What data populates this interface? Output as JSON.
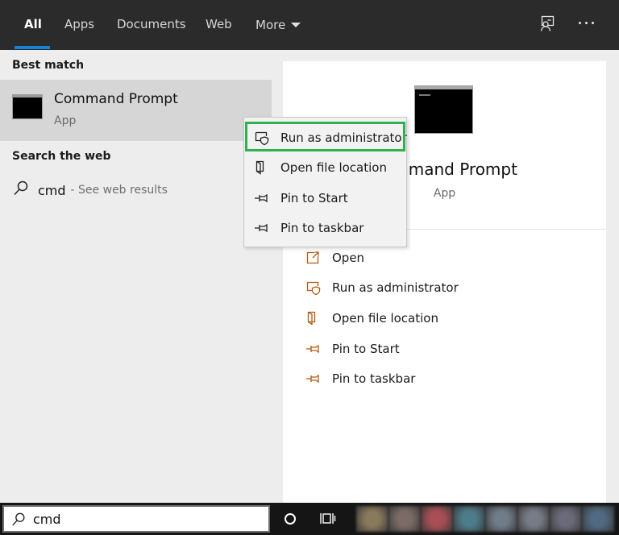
{
  "tabs": [
    {
      "label": "All",
      "active": true
    },
    {
      "label": "Apps",
      "active": false
    },
    {
      "label": "Documents",
      "active": false
    },
    {
      "label": "Web",
      "active": false
    },
    {
      "label": "More",
      "active": false
    }
  ],
  "top_icons": [
    "feedback-icon",
    "more-options-icon"
  ],
  "left": {
    "best_match_label": "Best match",
    "best_match": {
      "title": "Command Prompt",
      "subtitle": "App",
      "icon": "command-prompt-icon"
    },
    "search_web_label": "Search the web",
    "web_result": {
      "query": "cmd",
      "hint": "- See web results",
      "icon": "search-icon"
    }
  },
  "right": {
    "title": "Command Prompt",
    "subtitle": "App",
    "actions": [
      {
        "label": "Open",
        "icon": "open-icon"
      },
      {
        "label": "Run as administrator",
        "icon": "run-as-admin-icon"
      },
      {
        "label": "Open file location",
        "icon": "file-location-icon"
      },
      {
        "label": "Pin to Start",
        "icon": "pin-icon"
      },
      {
        "label": "Pin to taskbar",
        "icon": "pin-icon"
      }
    ]
  },
  "context_menu": {
    "items": [
      {
        "label": "Run as administrator",
        "icon": "run-as-admin-icon",
        "highlighted": true
      },
      {
        "label": "Open file location",
        "icon": "file-location-icon"
      },
      {
        "label": "Pin to Start",
        "icon": "pin-icon"
      },
      {
        "label": "Pin to taskbar",
        "icon": "pin-icon"
      }
    ],
    "highlight_color": "#2fb14c"
  },
  "taskbar": {
    "search_value": "cmd",
    "icons": [
      "search-icon",
      "cortana-icon",
      "task-view-icon"
    ],
    "pinned_app_colors": [
      "#8a7a5c",
      "#7c6b66",
      "#a84e55",
      "#4d7c8a",
      "#6f7c8a",
      "#777b85",
      "#6a6a78",
      "#4f6a82"
    ]
  },
  "colors": {
    "accent": "#1a7fd6",
    "topbar": "#2b2b2b",
    "icon_accent": "#b35a10"
  }
}
